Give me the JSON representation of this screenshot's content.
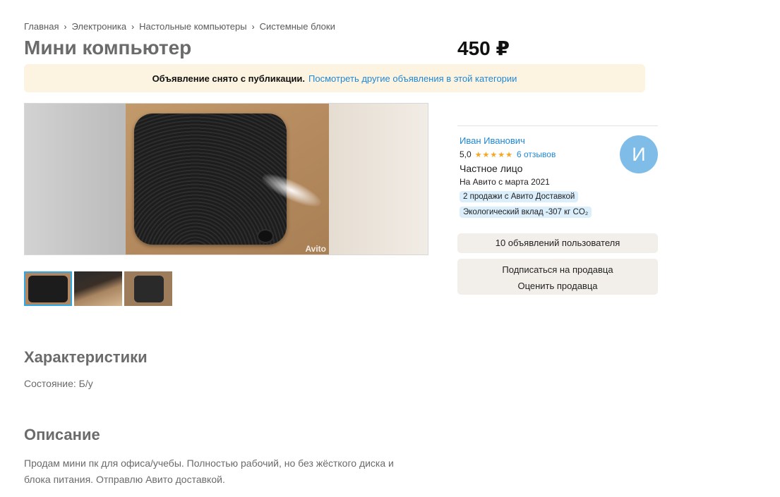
{
  "breadcrumb": [
    "Главная",
    "Электроника",
    "Настольные компьютеры",
    "Системные блоки"
  ],
  "listing": {
    "title": "Мини компьютер",
    "price": "450 ₽"
  },
  "notice": {
    "text": "Объявление снято с публикации.",
    "link": "Посмотреть другие объявления в этой категории"
  },
  "gallery": {
    "watermark": "Avito",
    "thumbnail_count": 3,
    "active_thumbnail": 1
  },
  "characteristics": {
    "title": "Характеристики",
    "condition": "Состояние: Б/у"
  },
  "description": {
    "title": "Описание",
    "line1": "Продам мини пк для офиса/учебы. Полностью рабочий, но без жёсткого диска и",
    "line2": "блока питания. Отправлю Авито доставкой."
  },
  "seller": {
    "name": "Иван Иванович",
    "rating": "5,0",
    "stars": 5,
    "reviews": "6 отзывов",
    "type": "Частное лицо",
    "since": "На Авито с марта 2021",
    "badge_delivery": "2 продажи с Авито Доставкой",
    "badge_eco": "Экологический вклад -307 кг CO₂",
    "avatar_letter": "И"
  },
  "buttons": {
    "ads": "10 объявлений пользователя",
    "subscribe": "Подписаться на продавца",
    "rate": "Оценить продавца"
  },
  "colors": {
    "link": "#1e88d6",
    "notice_bg": "#fdf3e1",
    "badge_bg": "#dbeefb",
    "avatar": "#7fbde8",
    "button_bg": "#f2efea"
  }
}
